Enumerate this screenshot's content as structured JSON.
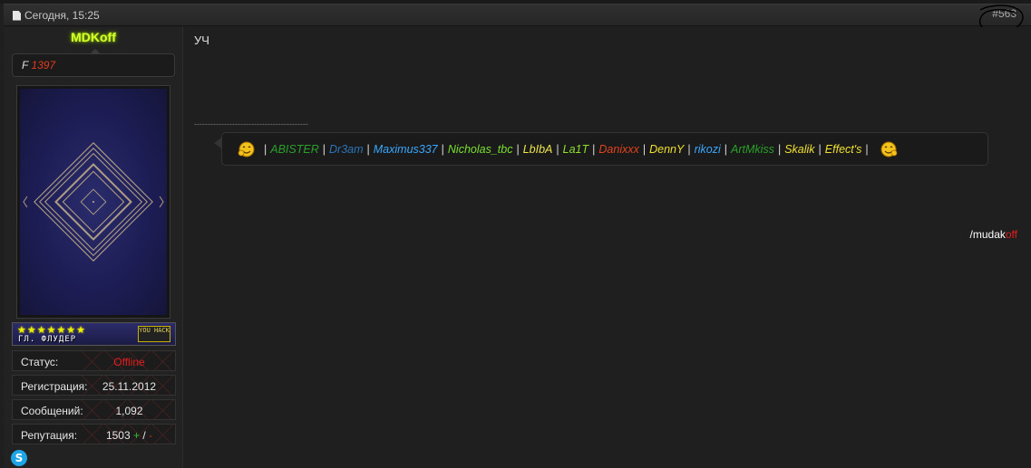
{
  "post": {
    "date": "Сегодня, 15:25",
    "number": "#563",
    "message": "УЧ"
  },
  "user": {
    "name": "MDKoff",
    "rep_prefix": "F ",
    "rep_value": "1397",
    "rank_stars": "★★★★★★★",
    "rank_title": "ГЛ. ФЛУДЕР",
    "rank_badge": "YOU HACK",
    "status_label": "Статус:",
    "status_value": "Offline",
    "reg_label": "Регистрация:",
    "reg_value": "25.11.2012",
    "posts_label": "Сообщений:",
    "posts_value": "1,092",
    "rep_label": "Репутация:",
    "rep_points": "1503",
    "rep_plus": "+",
    "rep_slash": " / ",
    "rep_minus": "-"
  },
  "signature": {
    "divider": "------------------------------------------",
    "sep": "|",
    "names": [
      {
        "name": "ABISTER",
        "color": "#2aa02a"
      },
      {
        "name": "Dr3am",
        "color": "#2b74b8"
      },
      {
        "name": "Maximus337",
        "color": "#3aa8ff"
      },
      {
        "name": "Nicholas_tbc",
        "color": "#7ae030"
      },
      {
        "name": "LbIbA",
        "color": "#f0e64a"
      },
      {
        "name": "La1T",
        "color": "#8ee02a"
      },
      {
        "name": "Danixxx",
        "color": "#e2431e"
      },
      {
        "name": "DennY",
        "color": "#f0e030"
      },
      {
        "name": "rikozi",
        "color": "#3aa8ff"
      },
      {
        "name": "ArtMkiss",
        "color": "#2aa02a"
      },
      {
        "name": "Skalik",
        "color": "#f0e030"
      },
      {
        "name": "Effect's",
        "color": "#f0e030"
      }
    ],
    "tail_main": "/mudak",
    "tail_hl": "off"
  },
  "icons": {
    "date": "document-icon",
    "smiley": "smiley-icon",
    "skype": "skype-icon"
  }
}
